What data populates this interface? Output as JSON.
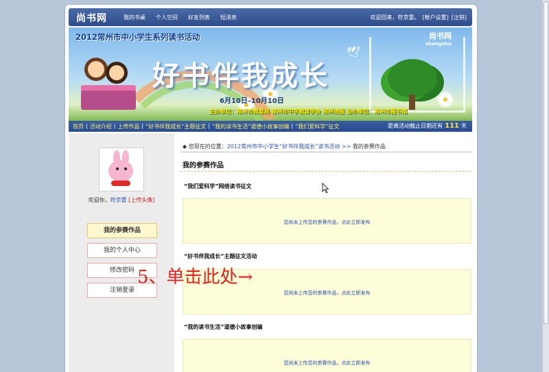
{
  "site": {
    "logo": "尚书网",
    "nav": [
      "我的书桌",
      "个人空间",
      "好友列表",
      "短消息"
    ],
    "account": {
      "greeting": "欢迎回来，符京雷。",
      "settings": "[帐户设置]",
      "logout": "[注销]"
    }
  },
  "banner": {
    "event_title": "2012常州市中小学生系列读书活动",
    "slogan": "好书伴我成长",
    "dates": "6月10日–10月10日",
    "hosts": "主办单位：常州市教育局  常州市中学教育学会  常州晚报  协办单位：常州市图书馆",
    "brand_cn": "尚书网",
    "brand_en": "shangshu"
  },
  "subnav": {
    "links": [
      "首页",
      "活动介绍",
      "上传作品",
      "“好书伴我成长”主题征文",
      "“我的读书生活”道德小故事创编",
      "“我们爱科学”征文"
    ],
    "deadline_prefix": "距离活动截止日期还有",
    "days_left": "111",
    "days_unit": "天"
  },
  "sidebar": {
    "welcome_prefix": "欢迎你，",
    "username": "符京雷",
    "upload_avatar": "[上传头像]",
    "menu": [
      "我的参赛作品",
      "我的个人中心",
      "修改密码",
      "注销登录"
    ]
  },
  "content": {
    "breadcrumb_prefix": "◆ 您现在的位置：",
    "breadcrumb_link": "2012常州市中小学生“好书伴我成长”读书活动",
    "breadcrumb_sep": ">>",
    "breadcrumb_current": "我的参赛作品",
    "heading": "我的参赛作品",
    "sections": [
      {
        "title": "“我们爱科学”网络读书征文",
        "empty": "您尚未上传您的参赛作品，点此立即发布"
      },
      {
        "title": "“好书伴我成长”主题征文活动",
        "empty": "您尚未上传您的参赛作品，点此立即发布"
      },
      {
        "title": "“我的读书生活”道德小故事创编",
        "empty": "您尚未上传您的参赛作品，点此立即发布"
      }
    ]
  },
  "annotation": "5、单击此处→"
}
